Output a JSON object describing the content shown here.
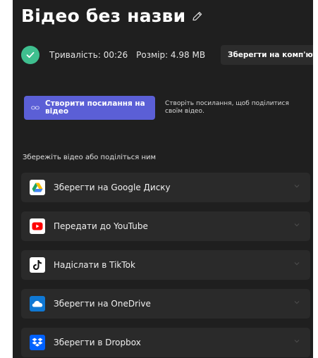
{
  "header": {
    "title": "Відео без назви"
  },
  "status": {
    "duration": "Тривалість: 00:26",
    "size": "Розмір: 4.98 MB",
    "save_computer_label": "Зберегти на комп'ютері"
  },
  "link": {
    "button_line1": "Створити посилання на",
    "button_line2": "відео",
    "description": "Створіть посилання, щоб поділитися своїм відео."
  },
  "share": {
    "section_label": "Збережіть відео або поділіться ним",
    "items": [
      {
        "label": "Зберегти на Google Диску",
        "icon": "google-drive-icon"
      },
      {
        "label": "Передати до YouTube",
        "icon": "youtube-icon"
      },
      {
        "label": "Надіслати в TikTok",
        "icon": "tiktok-icon"
      },
      {
        "label": "Зберегти на OneDrive",
        "icon": "onedrive-icon"
      },
      {
        "label": "Зберегти в Dropbox",
        "icon": "dropbox-icon"
      }
    ]
  },
  "colors": {
    "panel_bg": "#1f1f1f",
    "item_bg": "#2a2a2a",
    "accent": "#5b5fd6",
    "success": "#3fbf8f",
    "youtube": "#ff0000",
    "onedrive": "#0f78d4",
    "dropbox": "#0061fe"
  }
}
